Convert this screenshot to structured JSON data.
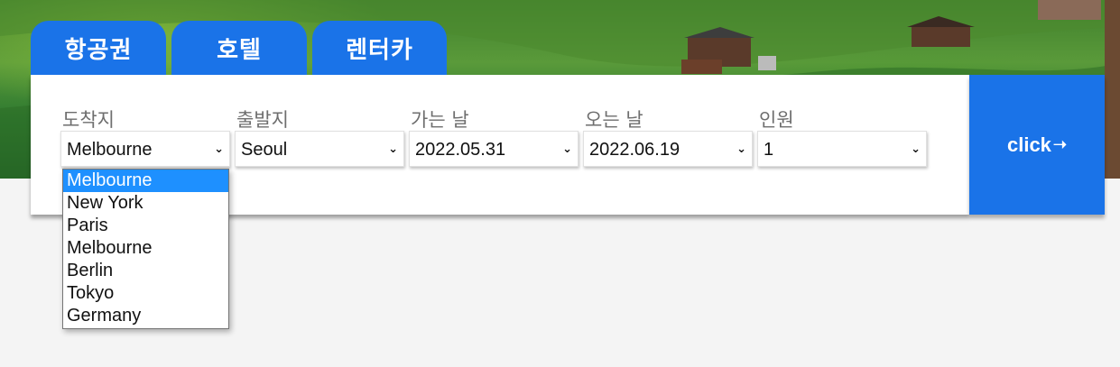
{
  "tabs": [
    {
      "label": "항공권"
    },
    {
      "label": "호텔"
    },
    {
      "label": "렌터카"
    }
  ],
  "fields": [
    {
      "label": "도착지",
      "value": "Melbourne"
    },
    {
      "label": "출발지",
      "value": "Seoul"
    },
    {
      "label": "가는 날",
      "value": "2022.05.31"
    },
    {
      "label": "오는 날",
      "value": "2022.06.19"
    },
    {
      "label": "인원",
      "value": "1"
    }
  ],
  "submit": {
    "label": "click",
    "icon": "arrow-right-icon"
  },
  "dropdown": {
    "selected": "Melbourne",
    "options": [
      "Melbourne",
      "New York",
      "Paris",
      "Melbourne",
      "Berlin",
      "Tokyo",
      "Germany"
    ]
  },
  "colors": {
    "accent": "#1a73e8",
    "highlight": "#1e90ff"
  },
  "icons": {
    "select_chevron": "chevron-down-icon"
  }
}
